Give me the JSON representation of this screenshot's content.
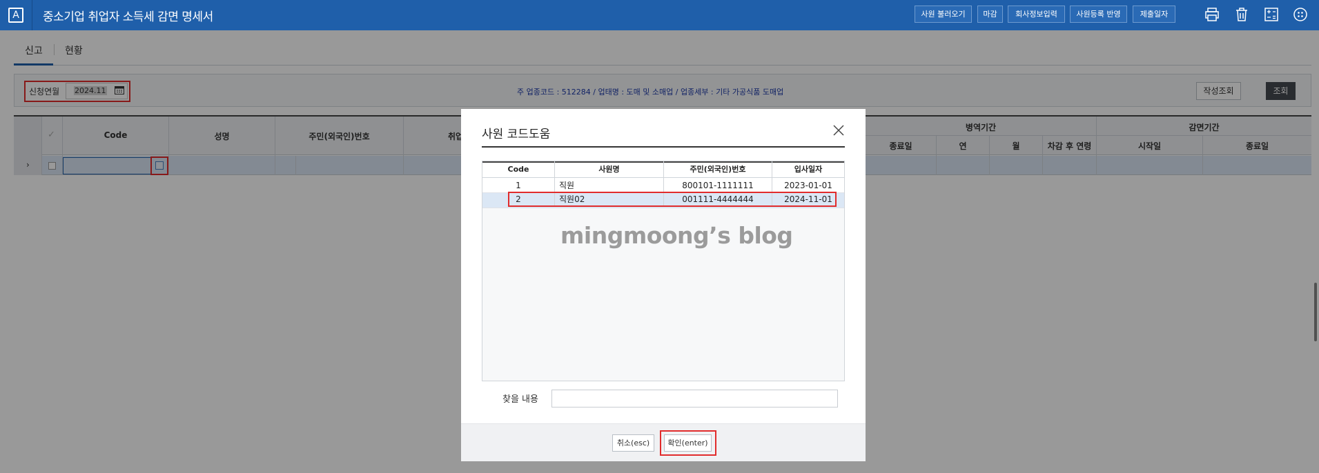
{
  "app": {
    "icon_letter": "A",
    "title": "중소기업 취업자 소득세 감면 명세서"
  },
  "toolbar": {
    "buttons": [
      "사원 불러오기",
      "마감",
      "회사정보입력",
      "사원등록 반영",
      "제출일자"
    ],
    "icons": [
      "print-icon",
      "trash-icon",
      "calculator-icon",
      "more-icon"
    ]
  },
  "tabs": [
    "신고",
    "현황"
  ],
  "filter": {
    "period_label": "신청연월",
    "period_value": "2024.11",
    "info": "주 업종코드 : 512284 / 업태명 : 도매 및 소매업 / 업종세부 : 기타 가공식품 도매업",
    "write_button": "작성조회",
    "search_button": "조회"
  },
  "grid": {
    "headers": {
      "code": "Code",
      "name": "성명",
      "rrn": "주민(외국인)번호",
      "employment": "취업",
      "military": "병역기간",
      "military_end": "종료일",
      "year": "연",
      "month": "월",
      "age_after": "차감 후 연령",
      "reduction": "감면기간",
      "reduction_start": "시작일",
      "reduction_end": "종료일"
    },
    "row_arrow": "›"
  },
  "modal": {
    "title": "사원 코드도움",
    "columns": [
      "Code",
      "사원명",
      "주민(외국인)번호",
      "입사일자"
    ],
    "rows": [
      {
        "code": "1",
        "name": "직원",
        "rrn": "800101-1111111",
        "date": "2023-01-01"
      },
      {
        "code": "2",
        "name": "직원02",
        "rrn": "001111-4444444",
        "date": "2024-11-01"
      }
    ],
    "selected_row": 2,
    "watermark": "mingmoong’s blog",
    "find_label": "찾을 내용",
    "find_value": "",
    "cancel_button": "취소(esc)",
    "ok_button": "확인(enter)"
  },
  "colors": {
    "header_bg": "#1f5faa",
    "highlight": "#e12b2b",
    "selected_row": "#dbe7f5"
  }
}
